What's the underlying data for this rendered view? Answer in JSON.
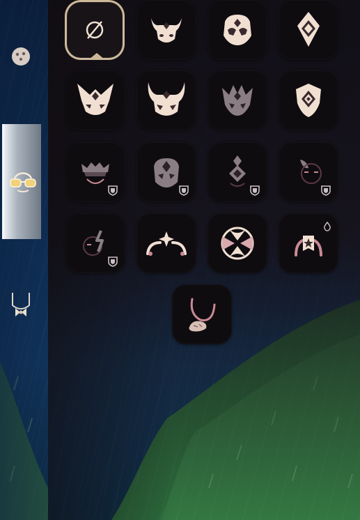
{
  "sidebar": {
    "items": [
      {
        "icon": "mask-face-icon",
        "selected": false
      },
      {
        "icon": "glasses-icon",
        "selected": true
      },
      {
        "icon": "necklace-icon",
        "selected": false
      }
    ]
  },
  "grid": {
    "items": [
      {
        "icon": "none-icon",
        "selected": true,
        "locked": false,
        "style": "none"
      },
      {
        "icon": "horned-mask-icon",
        "locked": false
      },
      {
        "icon": "dragon-mask-icon",
        "locked": false
      },
      {
        "icon": "diamond-crest-mask-icon",
        "locked": false
      },
      {
        "icon": "winged-mask-icon",
        "locked": false
      },
      {
        "icon": "horned-crown-mask-icon",
        "locked": false
      },
      {
        "icon": "spiked-crown-mask-icon",
        "locked": false,
        "dimmed": true
      },
      {
        "icon": "shield-crest-mask-icon",
        "locked": false
      },
      {
        "icon": "tiara-mask-icon",
        "locked": true
      },
      {
        "icon": "helmet-mask-icon",
        "locked": true
      },
      {
        "icon": "diamond-face-mask-icon",
        "locked": true
      },
      {
        "icon": "leaf-face-mask-icon",
        "locked": true
      },
      {
        "icon": "lightning-face-mask-icon",
        "locked": true
      },
      {
        "icon": "sparkle-horns-icon",
        "locked": false
      },
      {
        "icon": "bow-circle-mask-icon",
        "locked": false
      },
      {
        "icon": "banner-horns-icon",
        "locked": false,
        "badge": "drop"
      },
      {
        "icon": "candy-pendant-icon",
        "locked": false
      }
    ]
  },
  "colors": {
    "icon_fill": "#f1e0d2",
    "icon_dark": "#3a2a2e",
    "icon_dim": "#5a3a44",
    "accent_pink": "#c98a95",
    "selected_border": "#cdb99a",
    "hill_green": "#2f6a3e"
  }
}
